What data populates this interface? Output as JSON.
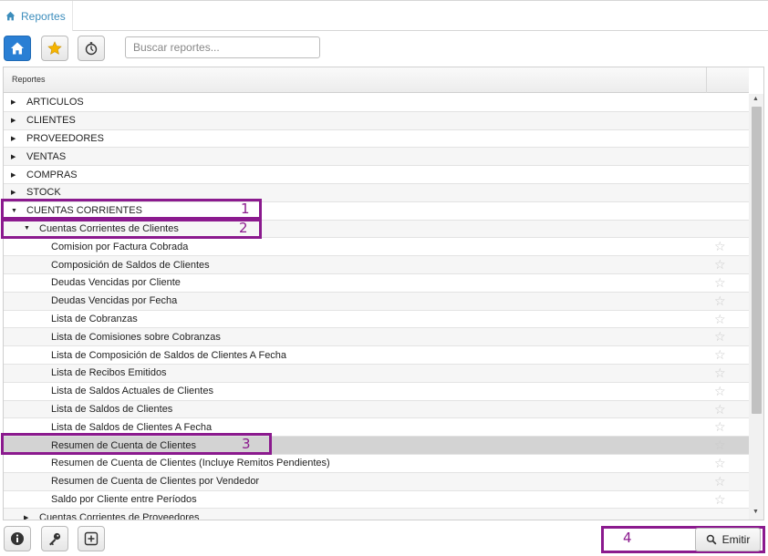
{
  "tab": {
    "label": "Reportes",
    "icon": "home-icon"
  },
  "toolbar": {
    "home_icon": "home-icon",
    "favorites_icon": "star-icon",
    "recent_icon": "stopwatch-icon",
    "search_placeholder": "Buscar reportes...",
    "search_value": ""
  },
  "grid": {
    "header": "Reportes",
    "rows": [
      {
        "label": "ARTICULOS",
        "level": 0,
        "caret": "collapsed"
      },
      {
        "label": "CLIENTES",
        "level": 0,
        "caret": "collapsed"
      },
      {
        "label": "PROVEEDORES",
        "level": 0,
        "caret": "collapsed"
      },
      {
        "label": "VENTAS",
        "level": 0,
        "caret": "collapsed"
      },
      {
        "label": "COMPRAS",
        "level": 0,
        "caret": "collapsed"
      },
      {
        "label": "STOCK",
        "level": 0,
        "caret": "collapsed"
      },
      {
        "label": "CUENTAS CORRIENTES",
        "level": 0,
        "caret": "expanded"
      },
      {
        "label": "Cuentas Corrientes de Clientes",
        "level": 1,
        "caret": "expanded"
      },
      {
        "label": "Comision por Factura Cobrada",
        "level": 2,
        "star": true
      },
      {
        "label": "Composición de Saldos de Clientes",
        "level": 2,
        "star": true
      },
      {
        "label": "Deudas Vencidas por Cliente",
        "level": 2,
        "star": true
      },
      {
        "label": "Deudas Vencidas por Fecha",
        "level": 2,
        "star": true
      },
      {
        "label": "Lista de Cobranzas",
        "level": 2,
        "star": true
      },
      {
        "label": "Lista de Comisiones sobre Cobranzas",
        "level": 2,
        "star": true
      },
      {
        "label": "Lista de Composición de Saldos de Clientes A Fecha",
        "level": 2,
        "star": true
      },
      {
        "label": "Lista de Recibos Emitidos",
        "level": 2,
        "star": true
      },
      {
        "label": "Lista de Saldos Actuales de Clientes",
        "level": 2,
        "star": true
      },
      {
        "label": "Lista de Saldos de Clientes",
        "level": 2,
        "star": true
      },
      {
        "label": "Lista de Saldos de Clientes A Fecha",
        "level": 2,
        "star": true
      },
      {
        "label": "Resumen de Cuenta de Clientes",
        "level": 2,
        "star": true,
        "selected": true
      },
      {
        "label": "Resumen de Cuenta de Clientes (Incluye Remitos Pendientes)",
        "level": 2,
        "star": true
      },
      {
        "label": "Resumen de Cuenta de Clientes por Vendedor",
        "level": 2,
        "star": true
      },
      {
        "label": "Saldo por Cliente entre Períodos",
        "level": 2,
        "star": true
      },
      {
        "label": "Cuentas Corrientes de Proveedores",
        "level": 1,
        "caret": "collapsed"
      }
    ],
    "star_glyph": "☆",
    "caret_collapsed": "▶",
    "caret_expanded": "▼",
    "scroll_up": "▲",
    "scroll_down": "▼"
  },
  "annotations": [
    "1",
    "2",
    "3",
    "4"
  ],
  "annotation_color": "#8b1a8e",
  "bottom": {
    "info_icon": "info-icon",
    "key_icon": "key-icon",
    "expand_icon": "plus-square-icon",
    "emit_label": "Emitir",
    "emit_icon": "search-icon"
  },
  "colors": {
    "accent": "#2a7fd4",
    "tab_text": "#3c8dbc",
    "selected_row": "#d3d3d3"
  }
}
